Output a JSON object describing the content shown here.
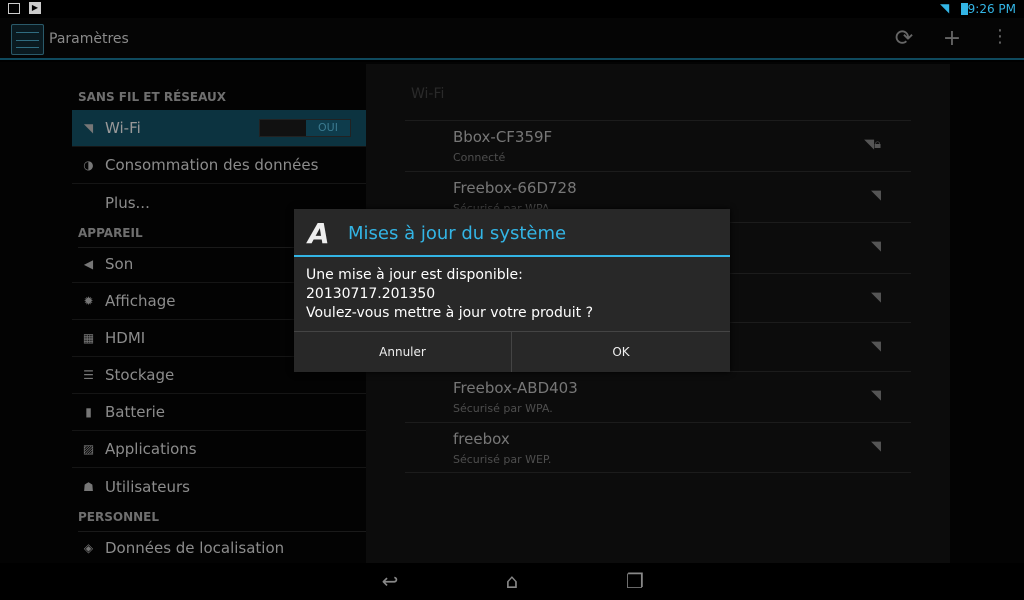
{
  "status_bar": {
    "time": "9:26 PM",
    "icons": [
      "gallery-icon",
      "play-store-icon",
      "wifi-icon",
      "battery-icon"
    ],
    "accent": "#33b5e5"
  },
  "action_bar": {
    "title": "Paramètres",
    "actions": [
      "sync-icon",
      "add-icon",
      "overflow-menu-icon"
    ]
  },
  "sidebar": {
    "sections": [
      {
        "header": "SANS FIL ET RÉSEAUX",
        "items": [
          {
            "label": "Wi-Fi",
            "icon": "wifi-icon",
            "toggle": "OUI",
            "selected": true
          },
          {
            "label": "Consommation des données",
            "icon": "data-usage-icon"
          },
          {
            "label": "Plus...",
            "icon": ""
          }
        ]
      },
      {
        "header": "APPAREIL",
        "items": [
          {
            "label": "Son",
            "icon": "speaker-icon"
          },
          {
            "label": "Affichage",
            "icon": "brightness-icon"
          },
          {
            "label": "HDMI",
            "icon": "hdmi-icon"
          },
          {
            "label": "Stockage",
            "icon": "storage-icon"
          },
          {
            "label": "Batterie",
            "icon": "battery-icon"
          },
          {
            "label": "Applications",
            "icon": "apps-icon"
          },
          {
            "label": "Utilisateurs",
            "icon": "user-icon"
          }
        ]
      },
      {
        "header": "PERSONNEL",
        "items": [
          {
            "label": "Données de localisation",
            "icon": "location-icon"
          }
        ]
      }
    ]
  },
  "wifi_panel": {
    "header": "Wi-Fi",
    "networks": [
      {
        "name": "Bbox-CF359F",
        "status": "Connecté",
        "secured": true
      },
      {
        "name": "Freebox-66D728",
        "status": "Sécurisé par WPA.",
        "secured": true
      },
      {
        "name": "",
        "status": "",
        "secured": true
      },
      {
        "name": "",
        "status": "",
        "secured": false
      },
      {
        "name": "",
        "status": "",
        "secured": false
      },
      {
        "name": "Freebox-ABD403",
        "status": "Sécurisé par WPA.",
        "secured": true
      },
      {
        "name": "freebox",
        "status": "Sécurisé par WEP.",
        "secured": true
      }
    ]
  },
  "dialog": {
    "title": "Mises à jour du système",
    "lines": [
      "Une mise à jour est disponible:",
      "20130717.201350",
      "Voulez-vous mettre à jour votre produit ?"
    ],
    "cancel": "Annuler",
    "ok": "OK"
  },
  "nav_bar": [
    "back-icon",
    "home-icon",
    "recent-apps-icon"
  ]
}
